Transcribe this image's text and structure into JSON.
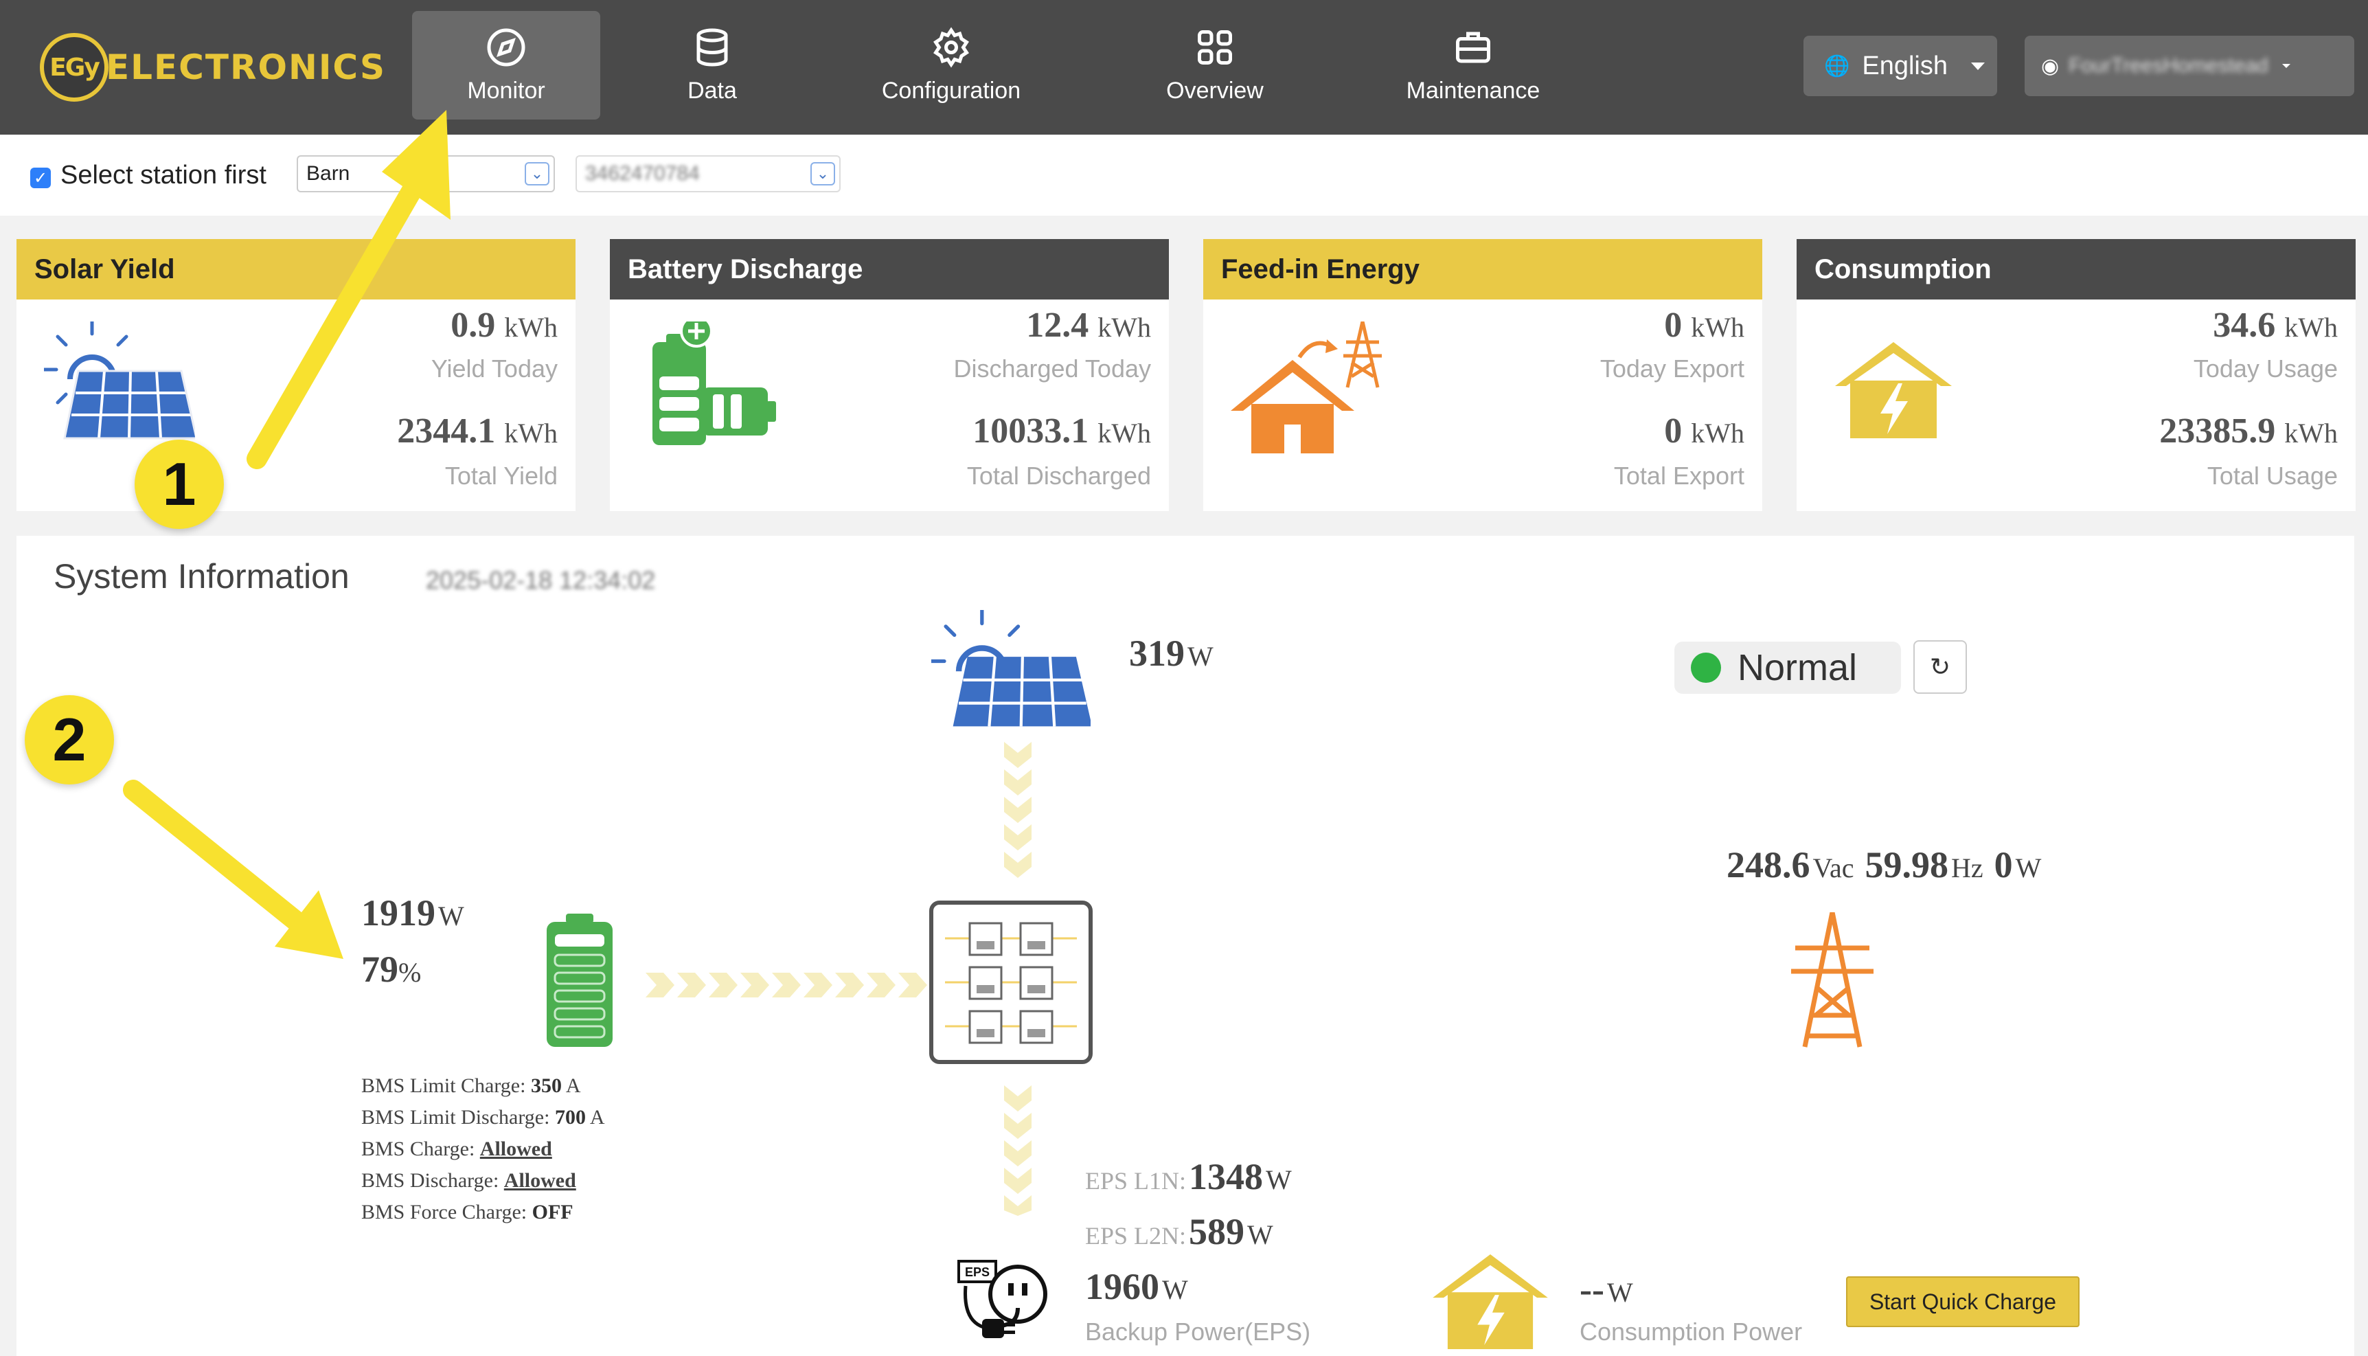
{
  "brand": {
    "logo_mark": "EGy",
    "logo_text": "ELECTRONICS"
  },
  "nav": {
    "items": [
      {
        "label": "Monitor",
        "icon": "compass-icon",
        "active": true
      },
      {
        "label": "Data",
        "icon": "database-icon"
      },
      {
        "label": "Configuration",
        "icon": "gear-icon"
      },
      {
        "label": "Overview",
        "icon": "grid-icon"
      },
      {
        "label": "Maintenance",
        "icon": "toolbox-icon"
      }
    ],
    "language": "English",
    "user": "FourTreesHomestead"
  },
  "station": {
    "checkbox_label": "Select station first",
    "checked": true,
    "station_value": "Barn",
    "device_value": "3462470784"
  },
  "cards": {
    "solar": {
      "title": "Solar Yield",
      "value1": "0.9",
      "unit1": "kWh",
      "label1": "Yield Today",
      "value2": "2344.1",
      "unit2": "kWh",
      "label2": "Total Yield"
    },
    "battery": {
      "title": "Battery Discharge",
      "value1": "12.4",
      "unit1": "kWh",
      "label1": "Discharged Today",
      "value2": "10033.1",
      "unit2": "kWh",
      "label2": "Total Discharged"
    },
    "feedin": {
      "title": "Feed-in Energy",
      "value1": "0",
      "unit1": "kWh",
      "label1": "Today Export",
      "value2": "0",
      "unit2": "kWh",
      "label2": "Total Export"
    },
    "consumption": {
      "title": "Consumption",
      "value1": "34.6",
      "unit1": "kWh",
      "label1": "Today Usage",
      "value2": "23385.9",
      "unit2": "kWh",
      "label2": "Total Usage"
    }
  },
  "system": {
    "title": "System Information",
    "timestamp": "2025-02-18 12:34:02",
    "pv_power": "319",
    "pv_unit": "W",
    "status": "Normal",
    "status_color": "#2fb344",
    "grid_voltage": "248.6",
    "grid_voltage_unit": "Vac",
    "grid_freq": "59.98",
    "grid_freq_unit": "Hz",
    "grid_power": "0",
    "grid_power_unit": "W",
    "battery_power": "1919",
    "battery_power_unit": "W",
    "soc": "79",
    "soc_unit": "%",
    "bms": {
      "limit_charge_label": "BMS Limit Charge:",
      "limit_charge": "350",
      "limit_charge_unit": "A",
      "limit_discharge_label": "BMS Limit Discharge:",
      "limit_discharge": "700",
      "limit_discharge_unit": "A",
      "charge_label": "BMS Charge:",
      "charge": "Allowed",
      "discharge_label": "BMS Discharge:",
      "discharge": "Allowed",
      "force_label": "BMS Force Charge:",
      "force": "OFF"
    },
    "eps_l1n_label": "EPS L1N:",
    "eps_l1n": "1348",
    "eps_l1n_unit": "W",
    "eps_l2n_label": "EPS L2N:",
    "eps_l2n": "589",
    "eps_l2n_unit": "W",
    "backup_power": "1960",
    "backup_unit": "W",
    "backup_label": "Backup Power(EPS)",
    "consumption_power": "--",
    "consumption_unit": "W",
    "consumption_label": "Consumption Power",
    "quick_charge": "Start Quick Charge"
  },
  "annotations": {
    "badge1": "1",
    "badge2": "2",
    "arrow_color": "#f8e12f"
  },
  "colors": {
    "accent": "#e9c946",
    "nav_bg": "#4a4a4a",
    "battery_green": "#4caf50",
    "grid_orange": "#f08a32",
    "solar_blue": "#3c6fc4"
  }
}
